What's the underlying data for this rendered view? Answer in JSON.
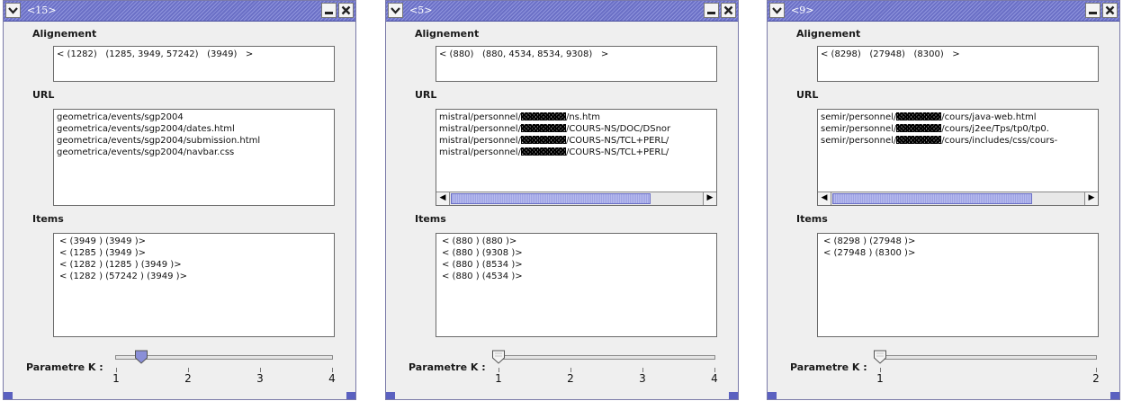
{
  "labels": {
    "alignment": "Alignement",
    "url": "URL",
    "items": "Items",
    "param": "Parametre K :"
  },
  "icons": {
    "menu": "chevron-down-icon",
    "minimize": "minimize-icon",
    "close": "close-icon"
  },
  "colors": {
    "titlebar": "#6b70c6",
    "slider_thumb_active": "#8a8fd8",
    "slider_thumb_inactive": "#f4f4f4"
  },
  "windows": [
    {
      "title": "<15>",
      "alignment": "< (1282)   (1285, 3949, 57242)   (3949)   >",
      "urls": [
        {
          "pre": "geometrica/events/sgp2004",
          "redacted": false,
          "post": ""
        },
        {
          "pre": "geometrica/events/sgp2004/dates.html",
          "redacted": false,
          "post": ""
        },
        {
          "pre": "geometrica/events/sgp2004/submission.html",
          "redacted": false,
          "post": ""
        },
        {
          "pre": "geometrica/events/sgp2004/navbar.css",
          "redacted": false,
          "post": ""
        }
      ],
      "has_hscroll": false,
      "items": [
        "< (3949 ) (3949 )>",
        "< (1285 ) (3949 )>",
        "< (1282 ) (1285 ) (3949 )>",
        "< (1282 ) (57242 ) (3949 )>"
      ],
      "slider": {
        "min": 1,
        "max": 4,
        "value": 1.35,
        "active": true,
        "ticks": [
          "1",
          "2",
          "3",
          "4"
        ]
      }
    },
    {
      "title": "<5>",
      "alignment": "< (880)   (880, 4534, 8534, 9308)   >",
      "urls": [
        {
          "pre": "mistral/personnel/",
          "redacted": true,
          "post": "/ns.htm"
        },
        {
          "pre": "mistral/personnel/",
          "redacted": true,
          "post": "/COURS-NS/DOC/DSnor"
        },
        {
          "pre": "mistral/personnel/",
          "redacted": true,
          "post": "/COURS-NS/TCL+PERL/"
        },
        {
          "pre": "mistral/personnel/",
          "redacted": true,
          "post": "/COURS-NS/TCL+PERL/"
        }
      ],
      "has_hscroll": true,
      "items": [
        "< (880 ) (880 )>",
        "< (880 ) (9308 )>",
        "< (880 ) (8534 )>",
        "< (880 ) (4534 )>"
      ],
      "slider": {
        "min": 1,
        "max": 4,
        "value": 1,
        "active": false,
        "ticks": [
          "1",
          "2",
          "3",
          "4"
        ]
      }
    },
    {
      "title": "<9>",
      "alignment": "< (8298)   (27948)   (8300)   >",
      "urls": [
        {
          "pre": "semir/personnel/",
          "redacted": true,
          "post": "/cours/java-web.html"
        },
        {
          "pre": "semir/personnel/",
          "redacted": true,
          "post": "/cours/j2ee/Tps/tp0/tp0."
        },
        {
          "pre": "semir/personnel/",
          "redacted": true,
          "post": "/cours/includes/css/cours-"
        }
      ],
      "has_hscroll": true,
      "items": [
        "< (8298 ) (27948 )>",
        "< (27948 ) (8300 )>"
      ],
      "slider": {
        "min": 1,
        "max": 2,
        "value": 1,
        "active": false,
        "ticks": [
          "1",
          "2"
        ]
      }
    }
  ]
}
